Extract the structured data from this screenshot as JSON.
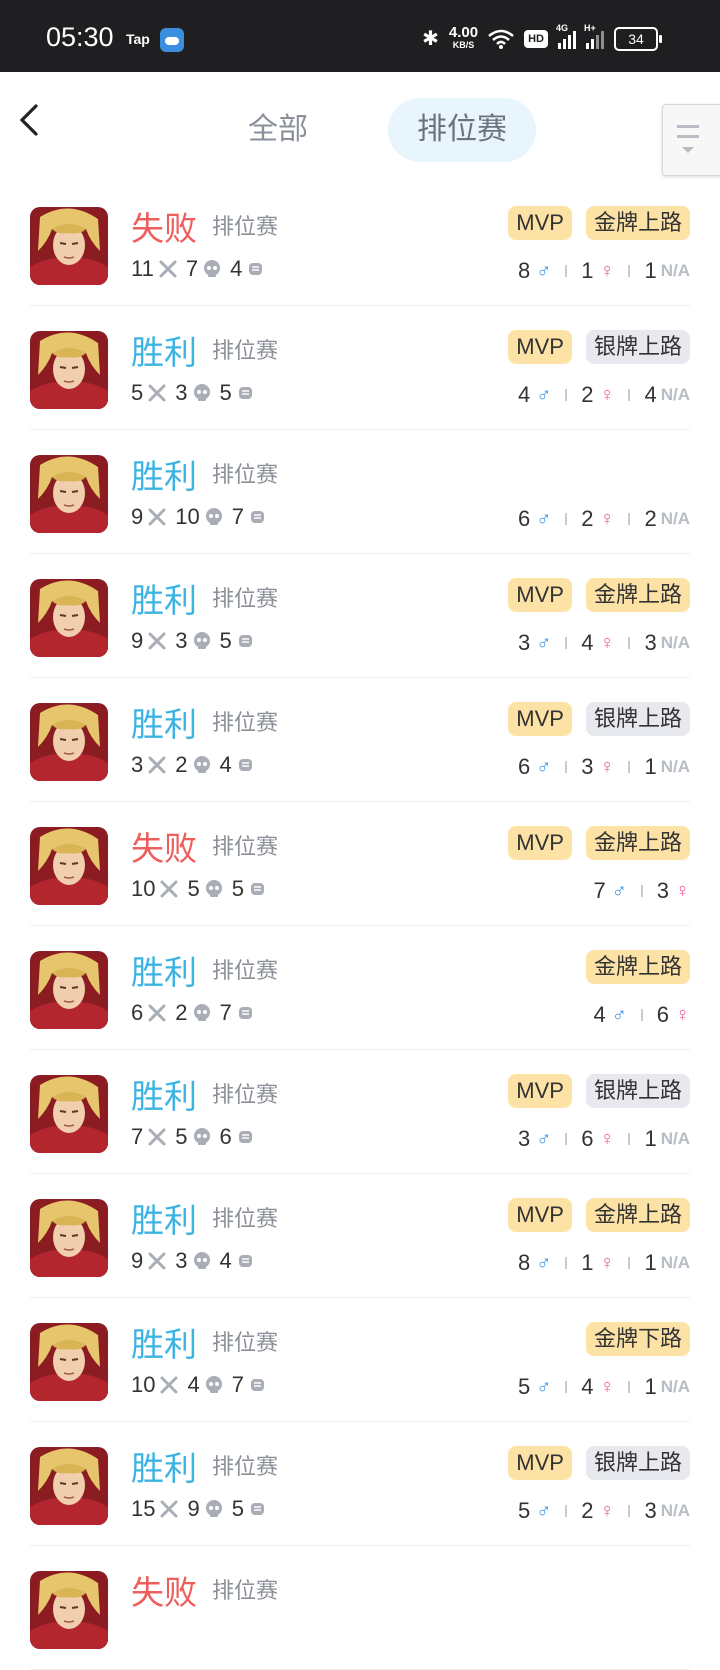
{
  "status_bar": {
    "time": "05:30",
    "tap_label": "Tap",
    "net_speed": "4.00",
    "net_unit": "KB/S",
    "hd_label": "HD",
    "signal1_label": "4G",
    "signal2_label": "H+",
    "battery": "34"
  },
  "header": {
    "tabs": [
      "全部",
      "排位赛"
    ],
    "active_tab": "排位赛"
  },
  "colors": {
    "win": "#3db3e3",
    "lose": "#ef5d5d",
    "mvp_bg": "#fde2a6",
    "silver_bg": "#e8e9ee",
    "tab_active_bg": "#e8f5fd"
  },
  "icons": {
    "kill": "crossed-swords-icon",
    "death": "skull-icon",
    "assist": "fist-icon",
    "male": "male-symbol-icon",
    "female": "female-symbol-icon"
  },
  "matches": [
    {
      "result": "失败",
      "mode": "排位赛",
      "kills": "11",
      "deaths": "7",
      "assists": "4",
      "badges": [
        "MVP",
        "金牌上路"
      ],
      "male": "8",
      "female": "1",
      "na": "1"
    },
    {
      "result": "胜利",
      "mode": "排位赛",
      "kills": "5",
      "deaths": "3",
      "assists": "5",
      "badges": [
        "MVP",
        "银牌上路"
      ],
      "male": "4",
      "female": "2",
      "na": "4"
    },
    {
      "result": "胜利",
      "mode": "排位赛",
      "kills": "9",
      "deaths": "10",
      "assists": "7",
      "badges": [],
      "male": "6",
      "female": "2",
      "na": "2"
    },
    {
      "result": "胜利",
      "mode": "排位赛",
      "kills": "9",
      "deaths": "3",
      "assists": "5",
      "badges": [
        "MVP",
        "金牌上路"
      ],
      "male": "3",
      "female": "4",
      "na": "3"
    },
    {
      "result": "胜利",
      "mode": "排位赛",
      "kills": "3",
      "deaths": "2",
      "assists": "4",
      "badges": [
        "MVP",
        "银牌上路"
      ],
      "male": "6",
      "female": "3",
      "na": "1"
    },
    {
      "result": "失败",
      "mode": "排位赛",
      "kills": "10",
      "deaths": "5",
      "assists": "5",
      "badges": [
        "MVP",
        "金牌上路"
      ],
      "male": "7",
      "female": "3",
      "na": null
    },
    {
      "result": "胜利",
      "mode": "排位赛",
      "kills": "6",
      "deaths": "2",
      "assists": "7",
      "badges": [
        "金牌上路"
      ],
      "male": "4",
      "female": "6",
      "na": null
    },
    {
      "result": "胜利",
      "mode": "排位赛",
      "kills": "7",
      "deaths": "5",
      "assists": "6",
      "badges": [
        "MVP",
        "银牌上路"
      ],
      "male": "3",
      "female": "6",
      "na": "1"
    },
    {
      "result": "胜利",
      "mode": "排位赛",
      "kills": "9",
      "deaths": "3",
      "assists": "4",
      "badges": [
        "MVP",
        "金牌上路"
      ],
      "male": "8",
      "female": "1",
      "na": "1"
    },
    {
      "result": "胜利",
      "mode": "排位赛",
      "kills": "10",
      "deaths": "4",
      "assists": "7",
      "badges": [
        "金牌下路"
      ],
      "male": "5",
      "female": "4",
      "na": "1"
    },
    {
      "result": "胜利",
      "mode": "排位赛",
      "kills": "15",
      "deaths": "9",
      "assists": "5",
      "badges": [
        "MVP",
        "银牌上路"
      ],
      "male": "5",
      "female": "2",
      "na": "3"
    },
    {
      "result": "失败",
      "mode": "排位赛",
      "kills": null,
      "deaths": null,
      "assists": null,
      "badges": [],
      "male": null,
      "female": null,
      "na": null
    }
  ],
  "na_label": "N/A"
}
